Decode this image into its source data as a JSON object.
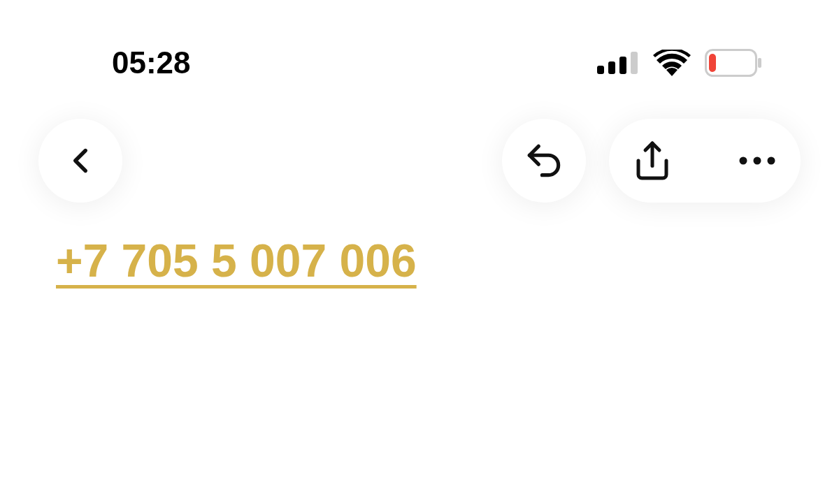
{
  "status_bar": {
    "time": "05:28"
  },
  "phone_link": {
    "text": "+7 705 5 007 006"
  }
}
